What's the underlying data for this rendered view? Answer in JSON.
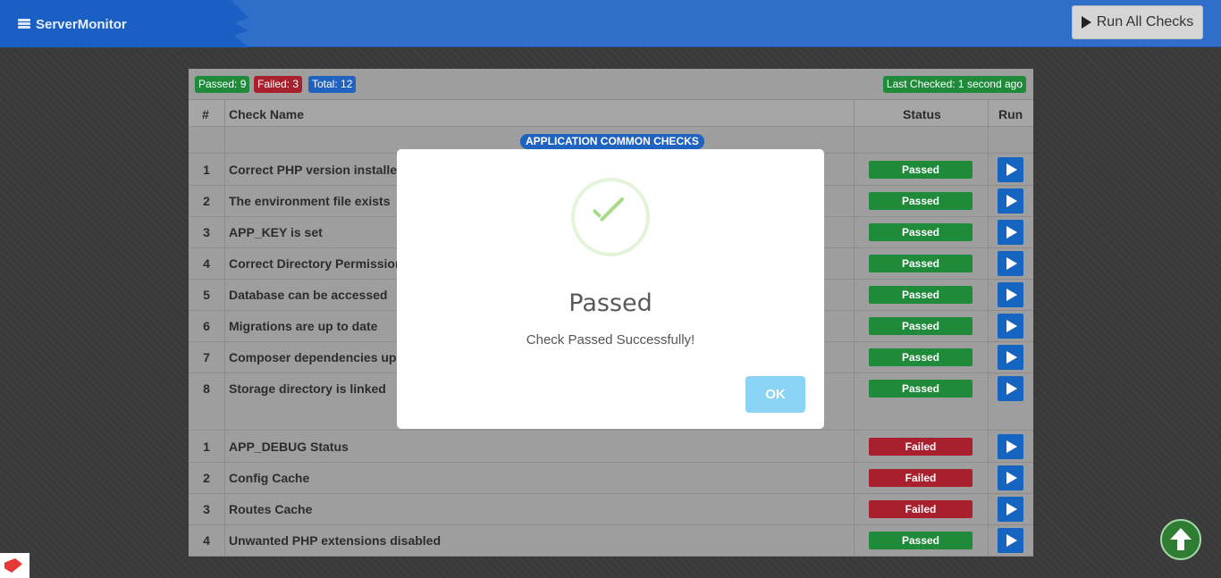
{
  "header": {
    "brand": "ServerMonitor",
    "run_all_label": "Run All Checks"
  },
  "summary": {
    "passed": "Passed: 9",
    "failed": "Failed: 3",
    "total": "Total: 12",
    "last_checked": "Last Checked: 1 second ago"
  },
  "table": {
    "columns": [
      "#",
      "Check Name",
      "Status",
      "Run"
    ],
    "section_1_title": "APPLICATION COMMON CHECKS",
    "section_1_rows": [
      {
        "num": "1",
        "name": "Correct PHP version installed",
        "status": "Passed"
      },
      {
        "num": "2",
        "name": "The environment file exists",
        "status": "Passed"
      },
      {
        "num": "3",
        "name": "APP_KEY is set",
        "status": "Passed"
      },
      {
        "num": "4",
        "name": "Correct Directory Permissions",
        "status": "Passed"
      },
      {
        "num": "5",
        "name": "Database can be accessed",
        "status": "Passed"
      },
      {
        "num": "6",
        "name": "Migrations are up to date",
        "status": "Passed"
      },
      {
        "num": "7",
        "name": "Composer dependencies up to date",
        "status": "Passed"
      },
      {
        "num": "8",
        "name": "Storage directory is linked",
        "status": "Passed"
      }
    ],
    "section_2_rows": [
      {
        "num": "1",
        "name": "APP_DEBUG Status",
        "status": "Failed"
      },
      {
        "num": "2",
        "name": "Config Cache",
        "status": "Failed"
      },
      {
        "num": "3",
        "name": "Routes Cache",
        "status": "Failed"
      },
      {
        "num": "4",
        "name": "Unwanted PHP extensions disabled",
        "status": "Passed"
      }
    ]
  },
  "modal": {
    "title": "Passed",
    "text": "Check Passed Successfully!",
    "ok_label": "OK"
  },
  "icons": {
    "brand": "server-icon",
    "run_all": "play-icon",
    "run_row": "play-icon",
    "modal": "success-check-icon",
    "to_top": "arrow-up-icon"
  },
  "colors": {
    "header": "#2f6ec9",
    "passed": "#1e8a3a",
    "failed": "#a8202d",
    "accent": "#1f62c0",
    "ok_button": "#8cd4f5",
    "success_check": "#a5dc86"
  }
}
